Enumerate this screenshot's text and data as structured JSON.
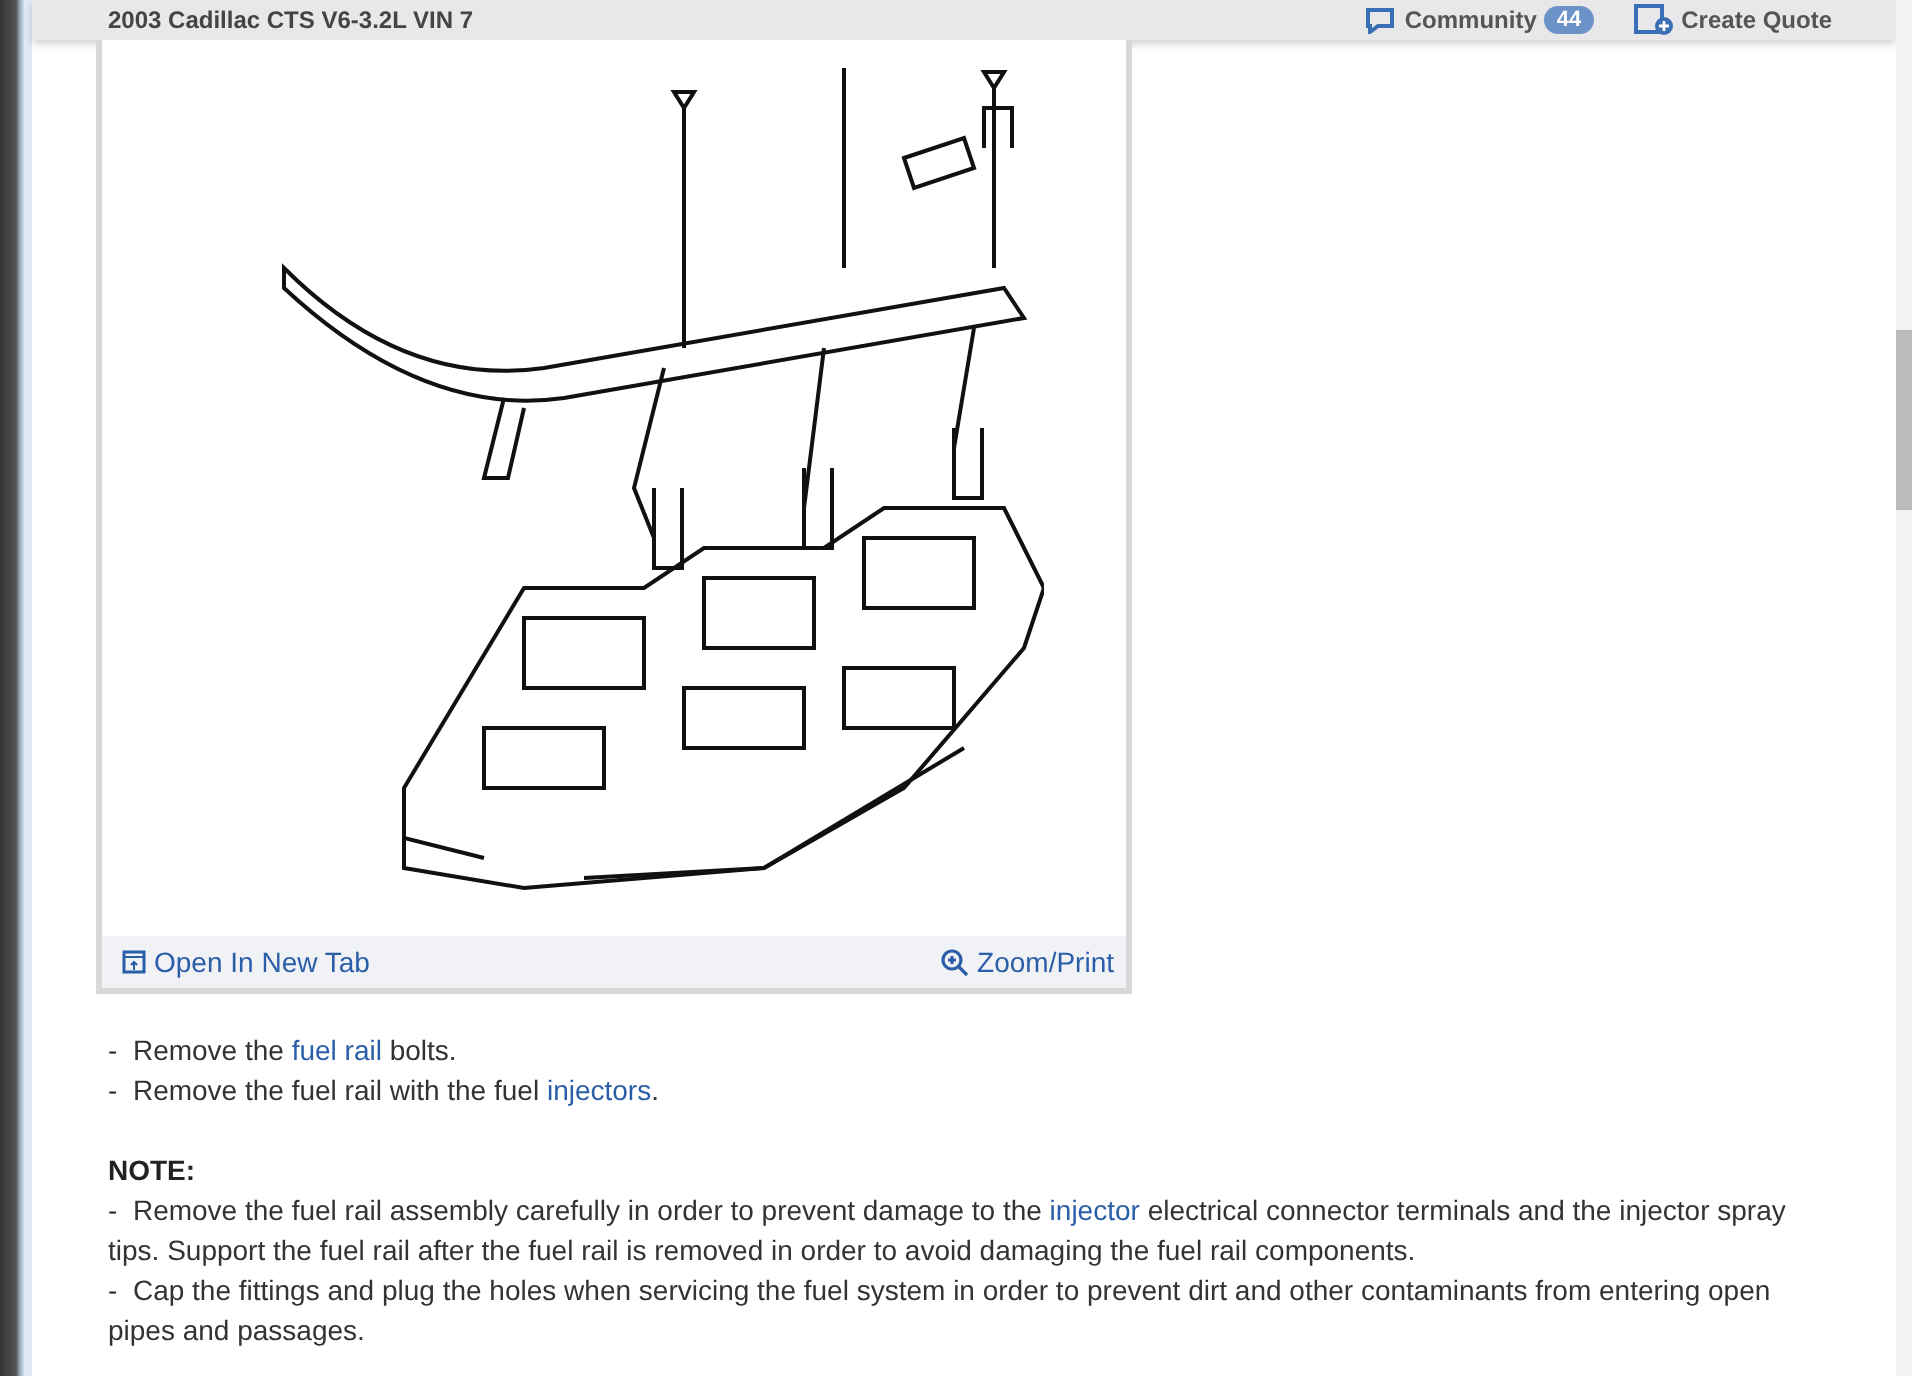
{
  "header": {
    "title": "2003 Cadillac CTS V6-3.2L VIN 7",
    "community": {
      "label": "Community",
      "count": "44"
    },
    "quote": {
      "label": "Create Quote"
    }
  },
  "figure": {
    "actions": [
      {
        "kind": "open",
        "label": "Open In New Tab"
      },
      {
        "kind": "zoom",
        "label": "Zoom/Print"
      }
    ]
  },
  "steps": [
    {
      "marker": "-",
      "parts": [
        {
          "text": "Remove the ",
          "kind": "plain"
        },
        {
          "text": "fuel rail",
          "kind": "link"
        },
        {
          "text": " bolts.",
          "kind": "plain"
        }
      ]
    },
    {
      "marker": "-",
      "parts": [
        {
          "text": "Remove the fuel rail with the fuel ",
          "kind": "plain"
        },
        {
          "text": "injectors",
          "kind": "link"
        },
        {
          "text": ".",
          "kind": "plain"
        }
      ]
    }
  ],
  "note": {
    "heading": "NOTE:",
    "items": [
      {
        "marker": "-",
        "parts": [
          {
            "text": "Remove the fuel rail assembly carefully in order to prevent damage to the ",
            "kind": "plain"
          },
          {
            "text": "injector",
            "kind": "link"
          },
          {
            "text": " electrical connector terminals and the injector spray tips. Support the fuel rail after the fuel rail is removed in order to avoid damaging the fuel rail components.",
            "kind": "plain"
          }
        ]
      },
      {
        "marker": "-",
        "parts": [
          {
            "text": "Cap the fittings and plug the holes when servicing the fuel system in order to prevent dirt and other contaminants from entering open pipes and passages.",
            "kind": "plain"
          }
        ]
      }
    ]
  }
}
